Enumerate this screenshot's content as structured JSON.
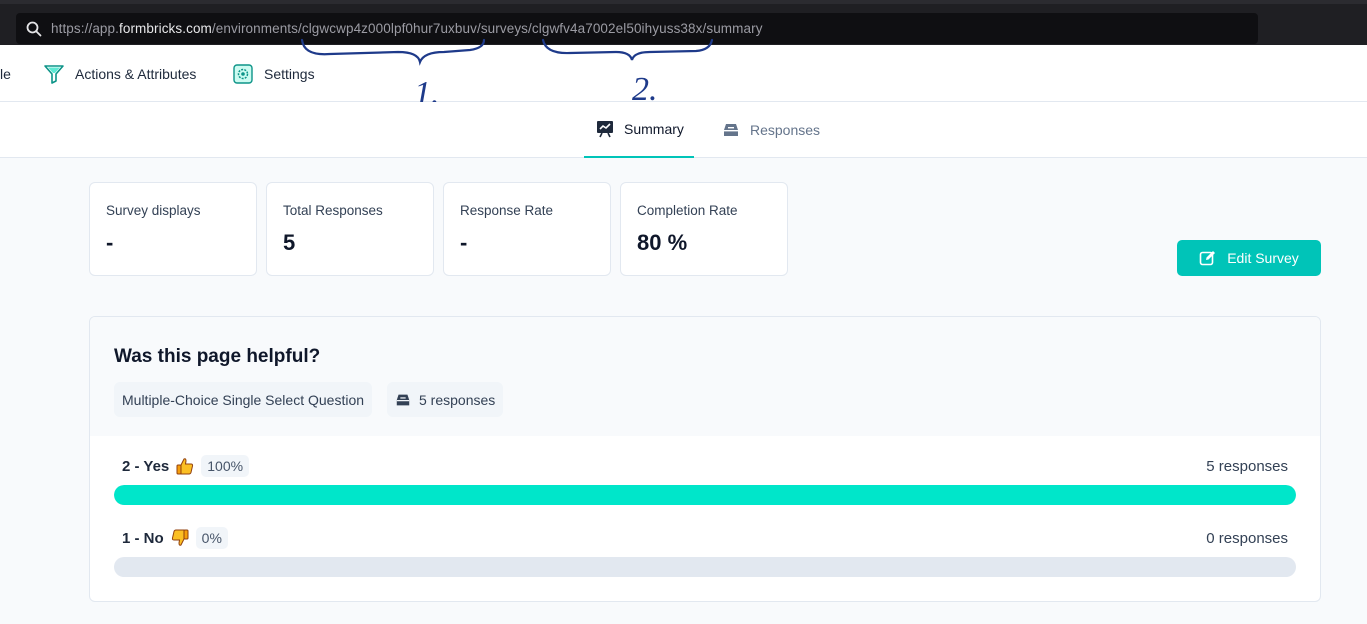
{
  "browser": {
    "url_prefix": "https://app.",
    "url_host": "formbricks.com",
    "url_path": "/environments/clgwcwp4z000lpf0hur7uxbuv/surveys/clgwfv4a7002el50ihyuss38x/summary"
  },
  "nav": {
    "partial_item_label": "le",
    "items": [
      {
        "label": "Actions & Attributes",
        "icon": "filter-icon"
      },
      {
        "label": "Settings",
        "icon": "settings-icon"
      }
    ]
  },
  "annotations": {
    "mark_1": "1.",
    "mark_2": "2."
  },
  "tabs": [
    {
      "label": "Summary",
      "icon": "presentation-chart-icon",
      "active": true
    },
    {
      "label": "Responses",
      "icon": "inbox-stack-icon",
      "active": false
    }
  ],
  "stats": [
    {
      "label": "Survey displays",
      "value": "-"
    },
    {
      "label": "Total Responses",
      "value": "5"
    },
    {
      "label": "Response Rate",
      "value": "-"
    },
    {
      "label": "Completion Rate",
      "value": "80 %"
    }
  ],
  "edit_button": {
    "label": "Edit Survey",
    "icon": "pencil-square-icon"
  },
  "question": {
    "title": "Was this page helpful?",
    "type_chip": "Multiple-Choice Single Select Question",
    "responses_chip": "5 responses",
    "options": [
      {
        "label": "2 - Yes",
        "emoji": "thumbs-up-icon",
        "percent_label": "100%",
        "responses": "5 responses",
        "fraction": 1.0
      },
      {
        "label": "1 - No",
        "emoji": "thumbs-down-icon",
        "percent_label": "0%",
        "responses": "0 responses",
        "fraction": 0.0
      }
    ]
  },
  "colors": {
    "brand": "#00c4b8",
    "bar_fill": "#00e6ca",
    "bar_track": "#e2e8f0"
  }
}
